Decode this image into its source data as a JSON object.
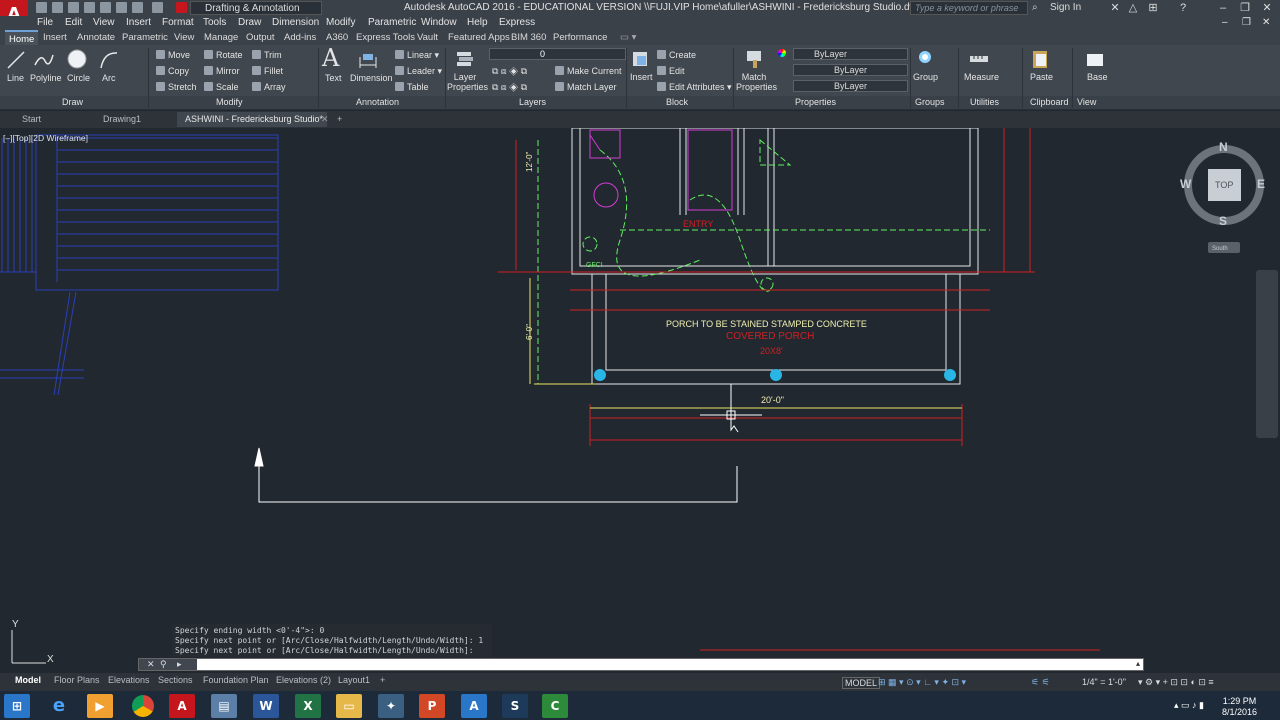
{
  "titlebar": {
    "workspace": "Drafting & Annotation",
    "title": "Autodesk AutoCAD 2016 - EDUCATIONAL VERSION    \\\\FUJI.VIP Home\\afuller\\ASHWINI - Fredericksburg Studio.dwg",
    "search_placeholder": "Type a keyword or phrase",
    "signin": "Sign In"
  },
  "app_logo": "A",
  "menubar": [
    "File",
    "Edit",
    "View",
    "Insert",
    "Format",
    "Tools",
    "Draw",
    "Dimension",
    "Modify",
    "Parametric",
    "Window",
    "Help",
    "Express"
  ],
  "ribbon_tabs": [
    "Home",
    "Insert",
    "Annotate",
    "Parametric",
    "View",
    "Manage",
    "Output",
    "Add-ins",
    "A360",
    "Express Tools",
    "Vault",
    "Featured Apps",
    "BIM 360",
    "Performance"
  ],
  "ribbon": {
    "draw": {
      "line": "Line",
      "polyline": "Polyline",
      "circle": "Circle",
      "arc": "Arc",
      "panel": "Draw"
    },
    "modify": {
      "move": "Move",
      "rotate": "Rotate",
      "trim": "Trim",
      "copy": "Copy",
      "mirror": "Mirror",
      "fillet": "Fillet",
      "stretch": "Stretch",
      "scale": "Scale",
      "array": "Array",
      "panel": "Modify"
    },
    "annotation": {
      "text": "Text",
      "dimension": "Dimension",
      "linear": "Linear",
      "leader": "Leader",
      "table": "Table",
      "panel": "Annotation"
    },
    "layers": {
      "layer_properties": "Layer Properties",
      "current_layer": "0",
      "make_current": "Make Current",
      "match_layer": "Match Layer",
      "panel": "Layers"
    },
    "block": {
      "insert": "Insert",
      "create": "Create",
      "edit": "Edit",
      "edit_attributes": "Edit Attributes",
      "panel": "Block"
    },
    "properties": {
      "match_properties": "Match Properties",
      "color": "ByLayer",
      "linetype": "ByLayer",
      "lineweight": "ByLayer",
      "panel": "Properties"
    },
    "groups": {
      "group": "Group",
      "panel": "Groups"
    },
    "utilities": {
      "measure": "Measure",
      "panel": "Utilities"
    },
    "clipboard": {
      "paste": "Paste",
      "panel": "Clipboard"
    },
    "view": {
      "base": "Base",
      "panel": "View"
    }
  },
  "file_tabs": [
    "Start",
    "Drawing1",
    "ASHWINI - Fredericksburg Studio*"
  ],
  "viewport_label": "[–][Top][2D Wireframe]",
  "drawing": {
    "note": "PORCH TO BE STAINED STAMPED CONCRETE",
    "porch_label": "COVERED PORCH",
    "porch_size": "20X8'",
    "dim_20": "20'-0\"",
    "dim_12": "12'-0\"",
    "dim_6": "6'-0\"",
    "entry": "ENTRY",
    "gfci": "GFCI"
  },
  "viewcube": {
    "n": "N",
    "s": "S",
    "e": "E",
    "w": "W",
    "face": "TOP",
    "wcs": "South"
  },
  "ucs": {
    "x": "X",
    "y": "Y"
  },
  "command": {
    "history": [
      "Specify ending width <0'-4\">: 0",
      "Specify next point or [Arc/Close/Halfwidth/Length/Undo/Width]: 1",
      "Specify next point or [Arc/Close/Halfwidth/Length/Undo/Width]:"
    ],
    "input": ""
  },
  "layout_tabs": [
    "Model",
    "Floor Plans",
    "Elevations",
    "Sections",
    "Foundation Plan",
    "Elevations (2)",
    "Layout1"
  ],
  "status": {
    "model": "MODEL",
    "scale": "1/4\" = 1'-0\""
  },
  "clock": {
    "time": "1:29 PM",
    "date": "8/1/2016"
  },
  "colors": {
    "accent": "#6da1d6",
    "autocad_red": "#c4161c",
    "canvas": "#212830"
  }
}
